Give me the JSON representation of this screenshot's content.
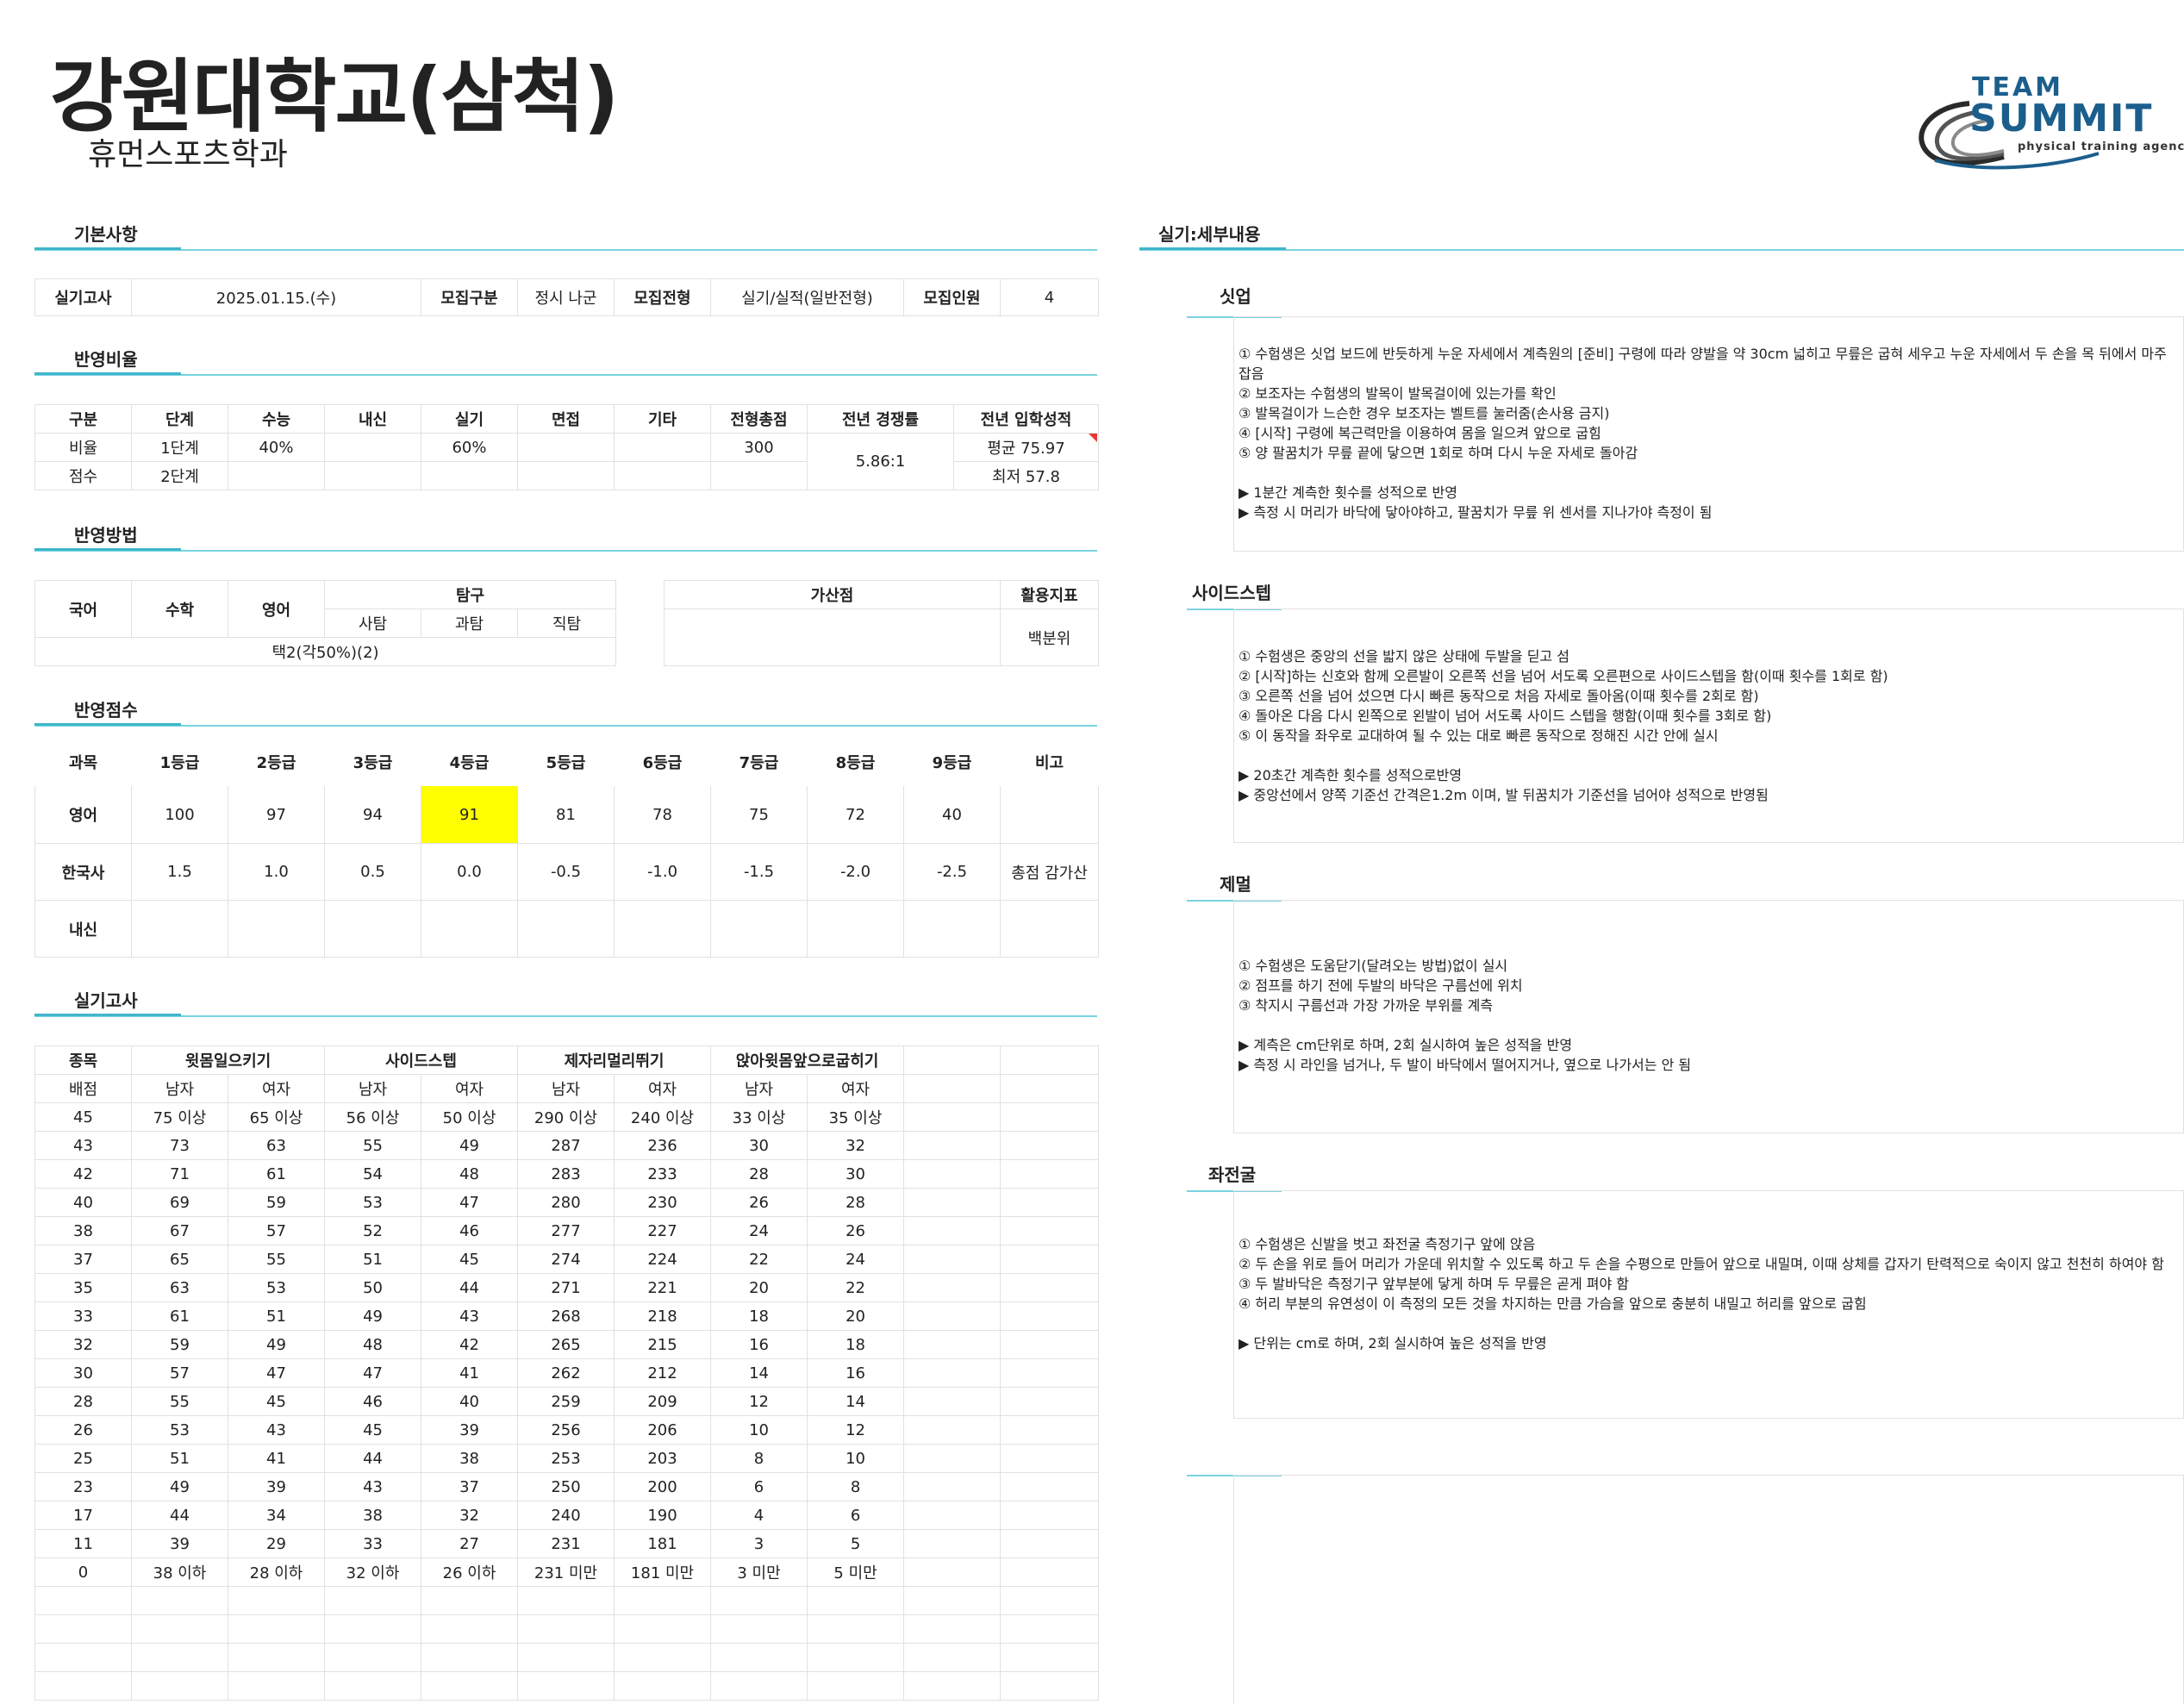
{
  "header": {
    "title": "강원대학교(삼척)",
    "subtitle": "휴먼스포츠학과",
    "logo_team": "TEAM",
    "logo_summit": "SUMMIT",
    "logo_tagline": "physical training agency",
    "logo_color": "#1b5e8c"
  },
  "sections": {
    "basic": "기본사항",
    "ratio": "반영비율",
    "method": "반영방법",
    "score": "반영점수",
    "practical": "실기고사",
    "details": "실기:세부내용"
  },
  "basic": {
    "exam_label": "실기고사",
    "exam_value": "2025.01.15.(수)",
    "group_label": "모집구분",
    "group_value": "정시 나군",
    "type_label": "모집전형",
    "type_value": "실기/실적(일반전형)",
    "count_label": "모집인원",
    "count_value": "4"
  },
  "ratio": {
    "headers": [
      "구분",
      "단계",
      "수능",
      "내신",
      "실기",
      "면접",
      "기타",
      "전형총점",
      "전년 경쟁률",
      "전년 입학성적"
    ],
    "row1": [
      "비율",
      "1단계",
      "40%",
      "",
      "60%",
      "",
      "",
      "300"
    ],
    "row2": [
      "점수",
      "2단계",
      "",
      "",
      "",
      "",
      "",
      ""
    ],
    "competition": "5.86:1",
    "avg": "평균 75.97",
    "min": "최저 57.8"
  },
  "method": {
    "korean": "국어",
    "math": "수학",
    "english": "영어",
    "inquiry": "탐구",
    "social": "사탐",
    "science": "과탐",
    "vocational": "직탐",
    "combo": "택2(각50%)(2)",
    "bonus": "가산점",
    "index": "활용지표",
    "index_value": "백분위"
  },
  "score": {
    "headers": [
      "과목",
      "1등급",
      "2등급",
      "3등급",
      "4등급",
      "5등급",
      "6등급",
      "7등급",
      "8등급",
      "9등급",
      "비고"
    ],
    "english": [
      "영어",
      "100",
      "97",
      "94",
      "91",
      "81",
      "78",
      "75",
      "72",
      "40",
      ""
    ],
    "history": [
      "한국사",
      "1.5",
      "1.0",
      "0.5",
      "0.0",
      "-0.5",
      "-1.0",
      "-1.5",
      "-2.0",
      "-2.5",
      "총점 감가산"
    ],
    "naesin": [
      "내신",
      "",
      "",
      "",
      "",
      "",
      "",
      "",
      "",
      "",
      ""
    ],
    "highlight_color": "#ffff00"
  },
  "practical": {
    "event_label": "종목",
    "events": [
      "윗몸일으키기",
      "사이드스텝",
      "제자리멀리뛰기",
      "앉아윗몸앞으로굽히기"
    ],
    "points_label": "배점",
    "male": "남자",
    "female": "여자",
    "rows": [
      [
        "45",
        "75 이상",
        "65 이상",
        "56 이상",
        "50 이상",
        "290 이상",
        "240 이상",
        "33 이상",
        "35 이상"
      ],
      [
        "43",
        "73",
        "63",
        "55",
        "49",
        "287",
        "236",
        "30",
        "32"
      ],
      [
        "42",
        "71",
        "61",
        "54",
        "48",
        "283",
        "233",
        "28",
        "30"
      ],
      [
        "40",
        "69",
        "59",
        "53",
        "47",
        "280",
        "230",
        "26",
        "28"
      ],
      [
        "38",
        "67",
        "57",
        "52",
        "46",
        "277",
        "227",
        "24",
        "26"
      ],
      [
        "37",
        "65",
        "55",
        "51",
        "45",
        "274",
        "224",
        "22",
        "24"
      ],
      [
        "35",
        "63",
        "53",
        "50",
        "44",
        "271",
        "221",
        "20",
        "22"
      ],
      [
        "33",
        "61",
        "51",
        "49",
        "43",
        "268",
        "218",
        "18",
        "20"
      ],
      [
        "32",
        "59",
        "49",
        "48",
        "42",
        "265",
        "215",
        "16",
        "18"
      ],
      [
        "30",
        "57",
        "47",
        "47",
        "41",
        "262",
        "212",
        "14",
        "16"
      ],
      [
        "28",
        "55",
        "45",
        "46",
        "40",
        "259",
        "209",
        "12",
        "14"
      ],
      [
        "26",
        "53",
        "43",
        "45",
        "39",
        "256",
        "206",
        "10",
        "12"
      ],
      [
        "25",
        "51",
        "41",
        "44",
        "38",
        "253",
        "203",
        "8",
        "10"
      ],
      [
        "23",
        "49",
        "39",
        "43",
        "37",
        "250",
        "200",
        "6",
        "8"
      ],
      [
        "17",
        "44",
        "34",
        "38",
        "32",
        "240",
        "190",
        "4",
        "6"
      ],
      [
        "11",
        "39",
        "29",
        "33",
        "27",
        "231",
        "181",
        "3",
        "5"
      ],
      [
        "0",
        "38 이하",
        "28 이하",
        "32 이하",
        "26 이하",
        "231 미만",
        "181 미만",
        "3 미만",
        "5 미만"
      ]
    ]
  },
  "details": [
    {
      "title": "싯업",
      "lines": [
        "① 수험생은 싯업 보드에 반듯하게 누운 자세에서 계측원의 [준비] 구령에 따라 양발을 약 30cm 넓히고 무릎은 굽혀 세우고 누운 자세에서 두 손을 목 뒤에서 마주 잡음",
        "② 보조자는 수험생의 발목이 발목걸이에 있는가를 확인",
        "③ 발목걸이가 느슨한 경우 보조자는 벨트를 눌러줌(손사용 금지)",
        "④ [시작] 구령에 복근력만을 이용하여 몸을 일으켜 앞으로 굽힘",
        "⑤ 양 팔꿈치가 무릎 끝에 닿으면 1회로 하며 다시 누운 자세로 돌아감",
        "",
        "▶ 1분간 계측한 횟수를 성적으로 반영",
        "▶ 측정 시 머리가 바닥에 닿아야하고, 팔꿈치가 무릎 위 센서를 지나가야 측정이 됨"
      ]
    },
    {
      "title": "사이드스텝",
      "lines": [
        "① 수험생은 중앙의 선을 밟지 않은 상태에 두발을 딛고 섬",
        "② [시작]하는 신호와 함께 오른발이 오른쪽 선을 넘어 서도록 오른편으로 사이드스텝을 함(이때 횟수를 1회로 함)",
        "③ 오른쪽 선을 넘어 섰으면 다시 빠른 동작으로 처음 자세로 돌아옴(이때 횟수를 2회로 함)",
        "④ 돌아온 다음 다시 왼쪽으로 왼발이 넘어 서도록 사이드 스텝을 행함(이때 횟수를 3회로 함)",
        "⑤ 이 동작을 좌우로 교대하여 될 수 있는 대로 빠른 동작으로 정해진 시간 안에 실시",
        "",
        "▶ 20초간 계측한 횟수를 성적으로반영",
        "▶ 중앙선에서 양쪽 기준선 간격은1.2m 이며, 발 뒤꿈치가 기준선을 넘어야 성적으로 반영됨"
      ]
    },
    {
      "title": "제멀",
      "lines": [
        "① 수험생은 도움닫기(달려오는 방법)없이 실시",
        "② 점프를 하기 전에 두발의 바닥은 구름선에 위치",
        "③ 착지시 구름선과 가장 가까운 부위를 계측",
        "",
        "▶ 계측은 cm단위로 하며, 2회 실시하여 높은 성적을 반영",
        "▶ 측정 시 라인을 넘거나, 두 발이 바닥에서 떨어지거나, 옆으로 나가서는 안 됨"
      ]
    },
    {
      "title": "좌전굴",
      "lines": [
        "① 수험생은 신발을 벗고 좌전굴 측정기구 앞에 앉음",
        "② 두 손을 위로 들어 머리가 가운데 위치할 수 있도록 하고 두 손을 수평으로 만들어 앞으로 내밀며, 이때 상체를 갑자기 탄력적으로 숙이지 않고 천천히 하여야 함",
        "③ 두 발바닥은 측정기구 앞부분에 닿게 하며 두 무릎은 곧게 펴야 함",
        "④ 허리 부분의 유연성이 이 측정의 모든 것을 차지하는 만큼 가슴을 앞으로 충분히 내밀고 허리를 앞으로 굽힘",
        "",
        "▶ 단위는 cm로 하며, 2회 실시하여 높은 성적을 반영"
      ]
    }
  ]
}
